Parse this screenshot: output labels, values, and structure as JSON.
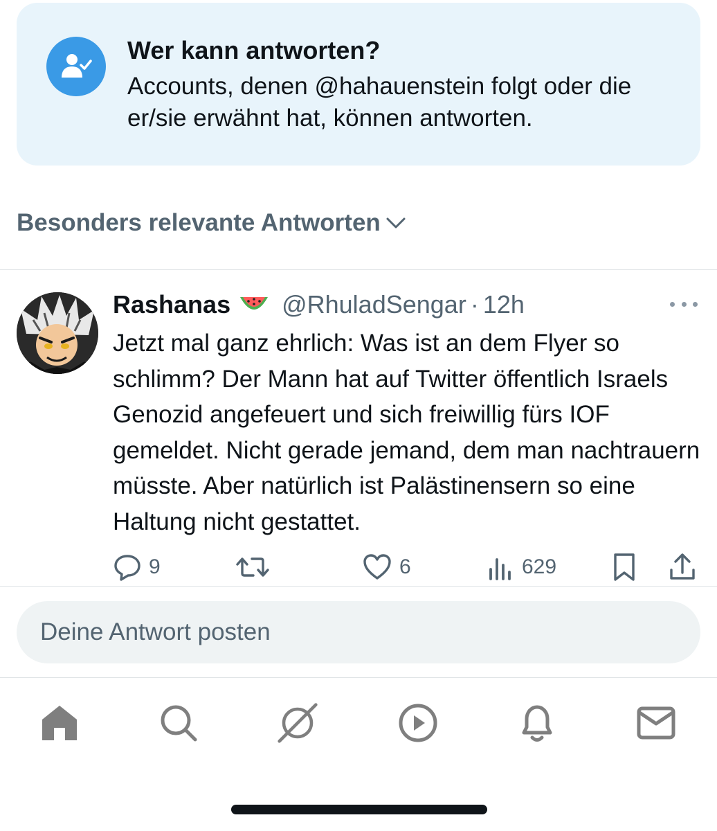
{
  "reply_restriction": {
    "title": "Wer kann antworten?",
    "description": "Accounts, denen @hahauenstein folgt oder die er/sie erwähnt hat, können antworten.",
    "icon": "person-check-icon",
    "accent_color": "#3a9ae6",
    "background_color": "#e8f4fb"
  },
  "sort": {
    "label": "Besonders relevante Antworten",
    "icon": "chevron-down-icon"
  },
  "tweet": {
    "author_name": "Rashanas",
    "author_emoji": "watermelon-emoji",
    "handle": "@RhuladSengar",
    "separator": "·",
    "time": "12h",
    "text": "Jetzt mal ganz ehrlich: Was ist an dem Flyer so schlimm? Der Mann hat auf Twitter öffentlich Israels Genozid angefeuert und sich freiwillig fürs IOF gemeldet. Nicht gerade jemand, dem man nachtrauern müsste. Aber natürlich ist Palästinensern so eine Haltung nicht gestattet.",
    "actions": {
      "replies": "9",
      "reposts": "",
      "likes": "6",
      "views": "629"
    }
  },
  "composer": {
    "placeholder": "Deine Antwort posten"
  },
  "bottom_nav": [
    {
      "name": "home-icon"
    },
    {
      "name": "search-icon"
    },
    {
      "name": "grok-icon"
    },
    {
      "name": "video-icon"
    },
    {
      "name": "notifications-icon"
    },
    {
      "name": "messages-icon"
    }
  ],
  "colors": {
    "text_primary": "#0f1419",
    "text_secondary": "#536471",
    "nav_icon": "#7f7f7f"
  }
}
